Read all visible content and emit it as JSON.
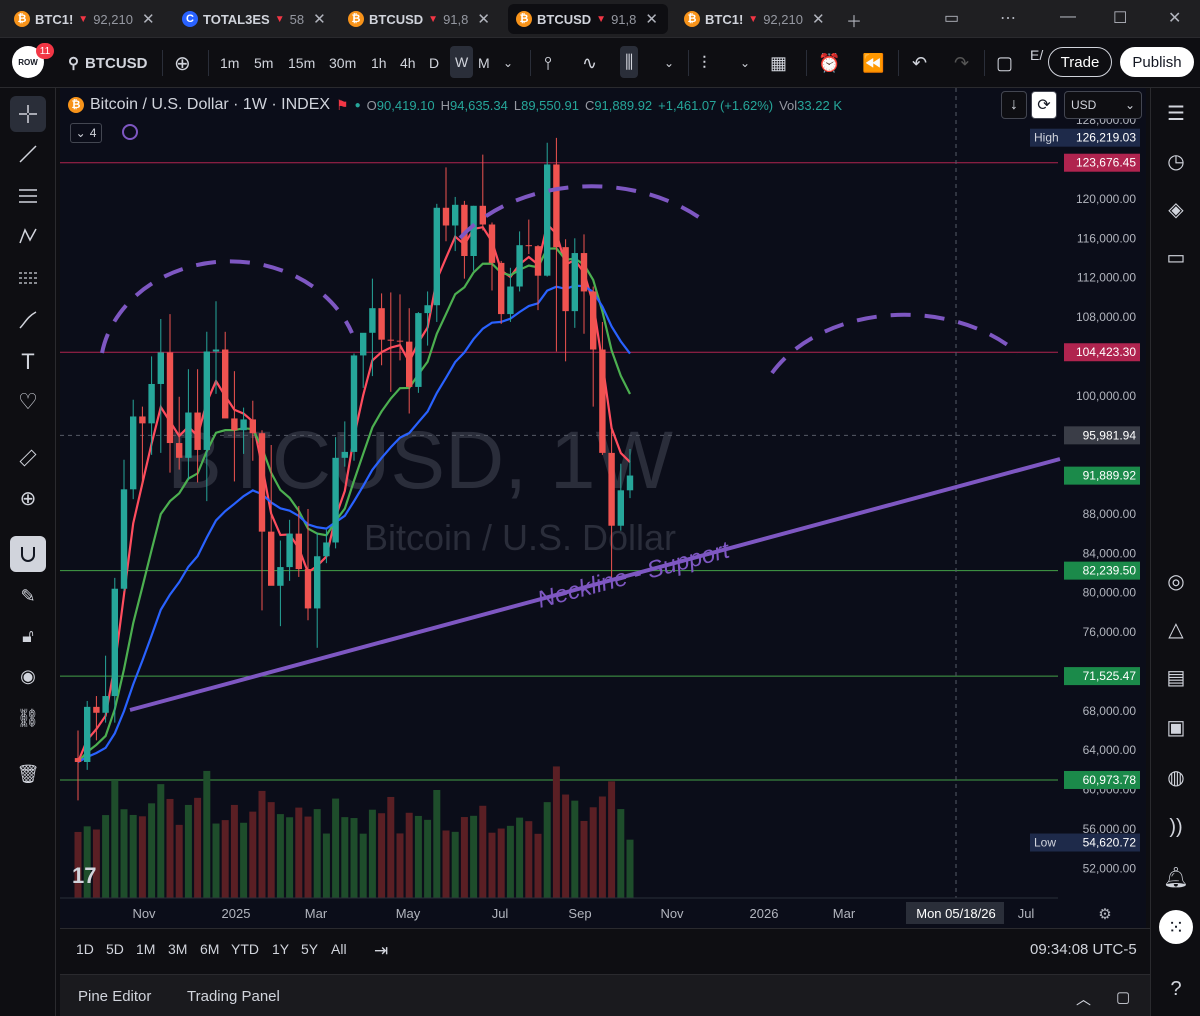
{
  "tabs": [
    {
      "symbol": "BTC1!",
      "arrow": "▼",
      "price": "92,210",
      "coin": "₿",
      "coin_style": "orange",
      "active": false
    },
    {
      "symbol": "TOTAL3ES",
      "arrow": "▼",
      "price": "58",
      "coin": "C",
      "coin_style": "blue",
      "active": false
    },
    {
      "symbol": "BTCUSD",
      "arrow": "▼",
      "price": "91,8",
      "coin": "₿",
      "coin_style": "orange",
      "active": false
    },
    {
      "symbol": "BTCUSD",
      "arrow": "▼",
      "price": "91,8",
      "coin": "₿",
      "coin_style": "orange",
      "active": true
    },
    {
      "symbol": "BTC1!",
      "arrow": "▼",
      "price": "92,210",
      "coin": "₿",
      "coin_style": "orange",
      "active": false
    }
  ],
  "toolbar": {
    "avatar_badge": "11",
    "avatar_text": "ROW",
    "symbol": "BTCUSD",
    "intervals": [
      "1m",
      "5m",
      "15m",
      "30m",
      "1h",
      "4h",
      "D",
      "W",
      "M"
    ],
    "selected_interval": "W",
    "trade_label": "Trade",
    "publish_label": "Publish",
    "e_label": "E/"
  },
  "legend": {
    "title": "Bitcoin / U.S. Dollar · 1W · INDEX",
    "open_label": "O",
    "open": "90,419.10",
    "high_label": "H",
    "high": "94,635.34",
    "low_label": "L",
    "low": "89,550.91",
    "close_label": "C",
    "close": "91,889.92",
    "change": "+1,461.07 (+1.62%)",
    "vol_label": "Vol",
    "vol": "33.22 K",
    "indicator_count": "4",
    "currency": "USD"
  },
  "watermark": {
    "main": "BTCUSD, 1W",
    "sub": "Bitcoin / U.S. Dollar"
  },
  "annotation": "Neckline - Support",
  "price_axis": {
    "ticks": [
      "128,000.00",
      "120,000.00",
      "116,000.00",
      "112,000.00",
      "108,000.00",
      "100,000.00",
      "88,000.00",
      "84,000.00",
      "80,000.00",
      "76,000.00",
      "68,000.00",
      "64,000.00",
      "60,000.00",
      "56,000.00",
      "52,000.00"
    ],
    "labels": [
      {
        "text": "126,219.03",
        "prefix": "High",
        "color": "#1e2a4a",
        "price": 126219.03
      },
      {
        "text": "123,676.45",
        "prefix": "",
        "color": "#b0244f",
        "price": 123676.45
      },
      {
        "text": "104,423.30",
        "prefix": "",
        "color": "#b0244f",
        "price": 104423.3
      },
      {
        "text": "95,981.94",
        "prefix": "",
        "color": "#3a3d47",
        "price": 95981.94
      },
      {
        "text": "91,889.92",
        "prefix": "",
        "color": "#1b8a4a",
        "price": 91889.92
      },
      {
        "text": "82,239.50",
        "prefix": "",
        "color": "#1b8a4a",
        "price": 82239.5
      },
      {
        "text": "71,525.47",
        "prefix": "",
        "color": "#1b8a4a",
        "price": 71525.47
      },
      {
        "text": "60,973.78",
        "prefix": "",
        "color": "#1b8a4a",
        "price": 60973.78
      },
      {
        "text": "54,620.72",
        "prefix": "Low",
        "color": "#1e2a4a",
        "price": 54620.72
      }
    ]
  },
  "time_axis": {
    "ticks": [
      "Nov",
      "2025",
      "Mar",
      "May",
      "Jul",
      "Sep",
      "Nov",
      "2026",
      "Mar",
      "Jul"
    ],
    "cursor_label": "Mon 05/18/26"
  },
  "ranges": [
    "1D",
    "5D",
    "1M",
    "3M",
    "6M",
    "YTD",
    "1Y",
    "5Y",
    "All"
  ],
  "clock": "09:34:08 UTC-5",
  "panels": [
    "Pine Editor",
    "Trading Panel"
  ],
  "colors": {
    "up": "#26a69a",
    "down": "#ef5350",
    "ema_fast": "#ff4d5e",
    "ema_mid": "#4caf50",
    "ema_slow": "#2962ff",
    "annotation": "#7e57c2"
  },
  "chart_data": {
    "type": "candlestick",
    "title": "Bitcoin / U.S. Dollar · 1W · INDEX",
    "ylim": [
      50000,
      128000
    ],
    "horizontal_levels": [
      123676.45,
      104423.3,
      82239.5,
      71525.47,
      60973.78
    ],
    "candles": [
      {
        "x": "2024-10-07",
        "o": 63200,
        "h": 66000,
        "l": 58900,
        "c": 62800
      },
      {
        "x": "2024-10-14",
        "o": 62800,
        "h": 69000,
        "l": 62000,
        "c": 68400
      },
      {
        "x": "2024-10-21",
        "o": 68400,
        "h": 69500,
        "l": 65000,
        "c": 67800
      },
      {
        "x": "2024-10-28",
        "o": 67800,
        "h": 73600,
        "l": 66800,
        "c": 69500
      },
      {
        "x": "2024-11-04",
        "o": 69500,
        "h": 81500,
        "l": 66800,
        "c": 80400
      },
      {
        "x": "2024-11-11",
        "o": 80400,
        "h": 93500,
        "l": 80200,
        "c": 90500
      },
      {
        "x": "2024-11-18",
        "o": 90500,
        "h": 99600,
        "l": 89500,
        "c": 97900
      },
      {
        "x": "2024-11-25",
        "o": 97900,
        "h": 98900,
        "l": 90800,
        "c": 97200
      },
      {
        "x": "2024-12-02",
        "o": 97200,
        "h": 104000,
        "l": 94000,
        "c": 101200
      },
      {
        "x": "2024-12-09",
        "o": 101200,
        "h": 107800,
        "l": 94200,
        "c": 104400
      },
      {
        "x": "2024-12-16",
        "o": 104400,
        "h": 108300,
        "l": 92200,
        "c": 95200
      },
      {
        "x": "2024-12-23",
        "o": 95200,
        "h": 99900,
        "l": 92500,
        "c": 93700
      },
      {
        "x": "2024-12-30",
        "o": 93700,
        "h": 102700,
        "l": 91500,
        "c": 98300
      },
      {
        "x": "2025-01-06",
        "o": 98300,
        "h": 102700,
        "l": 91200,
        "c": 94500
      },
      {
        "x": "2025-01-13",
        "o": 94500,
        "h": 106500,
        "l": 89300,
        "c": 104500
      },
      {
        "x": "2025-01-20",
        "o": 104500,
        "h": 109600,
        "l": 100200,
        "c": 104700
      },
      {
        "x": "2025-01-27",
        "o": 104700,
        "h": 106500,
        "l": 97800,
        "c": 97700
      },
      {
        "x": "2025-02-03",
        "o": 97700,
        "h": 102500,
        "l": 91300,
        "c": 96500
      },
      {
        "x": "2025-02-10",
        "o": 96500,
        "h": 98800,
        "l": 94100,
        "c": 97600
      },
      {
        "x": "2025-02-17",
        "o": 97600,
        "h": 99500,
        "l": 93400,
        "c": 96200
      },
      {
        "x": "2025-02-24",
        "o": 96200,
        "h": 96500,
        "l": 78200,
        "c": 86200
      },
      {
        "x": "2025-03-03",
        "o": 86200,
        "h": 95000,
        "l": 81400,
        "c": 80700
      },
      {
        "x": "2025-03-10",
        "o": 80700,
        "h": 85300,
        "l": 76600,
        "c": 82600
      },
      {
        "x": "2025-03-17",
        "o": 82600,
        "h": 87400,
        "l": 81200,
        "c": 86000
      },
      {
        "x": "2025-03-24",
        "o": 86000,
        "h": 88800,
        "l": 81600,
        "c": 82400
      },
      {
        "x": "2025-03-31",
        "o": 82400,
        "h": 88500,
        "l": 77200,
        "c": 78400
      },
      {
        "x": "2025-04-07",
        "o": 78400,
        "h": 86100,
        "l": 74400,
        "c": 83700
      },
      {
        "x": "2025-04-14",
        "o": 83700,
        "h": 86400,
        "l": 83000,
        "c": 85100
      },
      {
        "x": "2025-04-21",
        "o": 85100,
        "h": 95800,
        "l": 84500,
        "c": 93700
      },
      {
        "x": "2025-04-28",
        "o": 93700,
        "h": 97400,
        "l": 92800,
        "c": 94300
      },
      {
        "x": "2025-05-05",
        "o": 94300,
        "h": 104300,
        "l": 93400,
        "c": 104100
      },
      {
        "x": "2025-05-12",
        "o": 104100,
        "h": 105800,
        "l": 100800,
        "c": 106400
      },
      {
        "x": "2025-05-19",
        "o": 106400,
        "h": 111900,
        "l": 102000,
        "c": 108900
      },
      {
        "x": "2025-05-26",
        "o": 108900,
        "h": 110400,
        "l": 103100,
        "c": 105700
      },
      {
        "x": "2025-06-02",
        "o": 105700,
        "h": 110500,
        "l": 100400,
        "c": 105600
      },
      {
        "x": "2025-06-09",
        "o": 105600,
        "h": 110300,
        "l": 103600,
        "c": 105500
      },
      {
        "x": "2025-06-16",
        "o": 105500,
        "h": 108900,
        "l": 98200,
        "c": 100900
      },
      {
        "x": "2025-06-23",
        "o": 100900,
        "h": 108500,
        "l": 100300,
        "c": 108400
      },
      {
        "x": "2025-06-30",
        "o": 108400,
        "h": 110600,
        "l": 105100,
        "c": 109200
      },
      {
        "x": "2025-07-07",
        "o": 109200,
        "h": 119500,
        "l": 107500,
        "c": 119100
      },
      {
        "x": "2025-07-14",
        "o": 119100,
        "h": 123200,
        "l": 115700,
        "c": 117300
      },
      {
        "x": "2025-07-21",
        "o": 117300,
        "h": 120200,
        "l": 114700,
        "c": 119400
      },
      {
        "x": "2025-07-28",
        "o": 119400,
        "h": 119800,
        "l": 111900,
        "c": 114200
      },
      {
        "x": "2025-08-04",
        "o": 114200,
        "h": 119300,
        "l": 112700,
        "c": 119300
      },
      {
        "x": "2025-08-11",
        "o": 119300,
        "h": 124500,
        "l": 116800,
        "c": 117400
      },
      {
        "x": "2025-08-18",
        "o": 117400,
        "h": 117600,
        "l": 110700,
        "c": 113500
      },
      {
        "x": "2025-08-25",
        "o": 113500,
        "h": 113700,
        "l": 107300,
        "c": 108300
      },
      {
        "x": "2025-09-01",
        "o": 108300,
        "h": 113000,
        "l": 107500,
        "c": 111100
      },
      {
        "x": "2025-09-08",
        "o": 111100,
        "h": 116700,
        "l": 110600,
        "c": 115300
      },
      {
        "x": "2025-09-15",
        "o": 115300,
        "h": 117900,
        "l": 114400,
        "c": 115200
      },
      {
        "x": "2025-09-22",
        "o": 115200,
        "h": 115300,
        "l": 108700,
        "c": 112200
      },
      {
        "x": "2025-09-29",
        "o": 112200,
        "h": 125700,
        "l": 112100,
        "c": 123500
      },
      {
        "x": "2025-10-06",
        "o": 123500,
        "h": 126200,
        "l": 104500,
        "c": 115100
      },
      {
        "x": "2025-10-13",
        "o": 115100,
        "h": 115900,
        "l": 103500,
        "c": 108600
      },
      {
        "x": "2025-10-20",
        "o": 108600,
        "h": 116000,
        "l": 106900,
        "c": 114500
      },
      {
        "x": "2025-10-27",
        "o": 114500,
        "h": 116400,
        "l": 106300,
        "c": 110600
      },
      {
        "x": "2025-11-03",
        "o": 110600,
        "h": 111100,
        "l": 98900,
        "c": 104700
      },
      {
        "x": "2025-11-10",
        "o": 104700,
        "h": 107500,
        "l": 94000,
        "c": 94200
      },
      {
        "x": "2025-11-17",
        "o": 94200,
        "h": 96600,
        "l": 80600,
        "c": 86800
      },
      {
        "x": "2025-11-24",
        "o": 86800,
        "h": 93100,
        "l": 86300,
        "c": 90400
      },
      {
        "x": "2025-12-01",
        "o": 90400,
        "h": 94600,
        "l": 89600,
        "c": 91900
      }
    ],
    "series": [
      {
        "name": "EMA fast",
        "color": "#ff4d5e"
      },
      {
        "name": "EMA mid",
        "color": "#4caf50"
      },
      {
        "name": "EMA slow",
        "color": "#2962ff"
      }
    ]
  }
}
